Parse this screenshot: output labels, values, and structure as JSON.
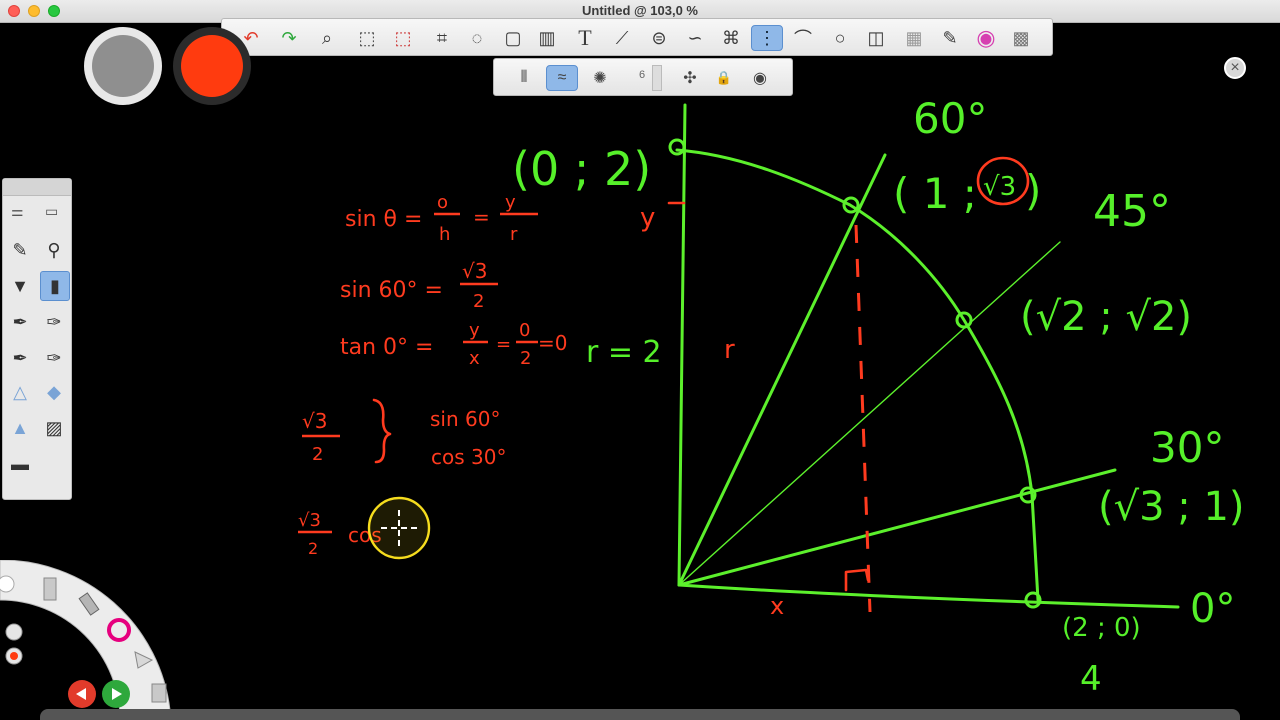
{
  "window": {
    "title": "Untitled @ 103,0 %"
  },
  "toolbar": {
    "tools": [
      {
        "name": "undo-icon",
        "glyph": "↶"
      },
      {
        "name": "redo-icon",
        "glyph": "↷"
      },
      {
        "name": "magnifier-icon",
        "glyph": "⌕"
      },
      {
        "name": "selection-icon",
        "glyph": "⬚"
      },
      {
        "name": "selection-add-icon",
        "glyph": "⬚"
      },
      {
        "name": "crop-icon",
        "glyph": "⌗"
      },
      {
        "name": "lasso-transform-icon",
        "glyph": "◌"
      },
      {
        "name": "transform-icon",
        "glyph": "▢"
      },
      {
        "name": "layers-icon",
        "glyph": "▥"
      },
      {
        "name": "text-icon",
        "glyph": "T"
      },
      {
        "name": "ruler-icon",
        "glyph": "⟋"
      },
      {
        "name": "ellipse-guide-icon",
        "glyph": "⊜"
      },
      {
        "name": "french-curve-icon",
        "glyph": "∽"
      },
      {
        "name": "perspective-icon",
        "glyph": "⌘"
      },
      {
        "name": "symmetry-icon",
        "glyph": "⋮"
      },
      {
        "name": "line-icon",
        "glyph": "⌒"
      },
      {
        "name": "circle-icon",
        "glyph": "○"
      },
      {
        "name": "shape-icon",
        "glyph": "◫"
      },
      {
        "name": "copic-icon",
        "glyph": "▦"
      },
      {
        "name": "brushes-icon",
        "glyph": "✎"
      },
      {
        "name": "color-wheel-icon",
        "glyph": "◉"
      },
      {
        "name": "brush-palette-icon",
        "glyph": "▩"
      }
    ]
  },
  "subbar": {
    "brush_size_value": "6",
    "tools": [
      {
        "name": "symmetry-vertical-icon",
        "glyph": "⦀"
      },
      {
        "name": "symmetry-wave-icon",
        "glyph": "≈"
      },
      {
        "name": "symmetry-radial-icon",
        "glyph": "✺"
      },
      {
        "name": "symmetry-center-icon",
        "glyph": "✣"
      },
      {
        "name": "lock-icon",
        "glyph": "🔒"
      },
      {
        "name": "visibility-eye-icon",
        "glyph": "◉"
      }
    ]
  },
  "colors": {
    "brush_gray": "#8f8f8f",
    "brush_red": "#ff3b0f",
    "ink_red": "#ff3b1f",
    "ink_green": "#5cf02c",
    "highlight_ring": "#f5dc1e"
  },
  "whiteboard": {
    "red_notes": {
      "sin_theta_left": "sin θ =",
      "o_num": "o",
      "h_den": "h",
      "y_num": "y",
      "r_den": "r",
      "eq1": "=",
      "sin60_left": "sin 60° =",
      "sqrt3_a": "√3",
      "two_a": "2",
      "tan0_left": "tan 0° =",
      "y2": "y",
      "x2": "x",
      "eq2": "=",
      "zero_num": "0",
      "two_b": "2",
      "eq_zero": "=0",
      "sqrt3_b": "√3",
      "two_c": "2",
      "sin60_b": "sin 60°",
      "cos30_b": "cos 30°",
      "sqrt3_c": "√3",
      "two_d": "2",
      "cos_d": "cos",
      "y_axis": "y",
      "r_mid": "r",
      "x_axis": "x"
    },
    "green_notes": {
      "point_0_2": "(0 ; 2)",
      "angle_60": "60°",
      "point_1_sqrt3_open": "( 1 ;",
      "point_1_sqrt3_val": "√3",
      "point_1_sqrt3_close": ")",
      "angle_45": "45°",
      "point_sqrt2": "(√2 ; √2)",
      "r_eq_2": "r = 2",
      "angle_30": "30°",
      "point_sqrt3_1": "(√3 ; 1)",
      "point_2_0": "(2 ; 0)",
      "angle_0": "0°",
      "number_4": "4"
    }
  }
}
